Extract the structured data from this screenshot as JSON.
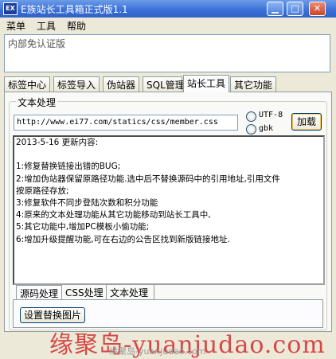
{
  "window": {
    "app_icon": "EX",
    "title": "E族站长工具箱正式版1.1",
    "minimize_icon": "minimize-icon",
    "maximize_icon": "maximize-icon",
    "close_icon": "close-icon"
  },
  "menu": [
    {
      "label": "菜单"
    },
    {
      "label": "工具"
    },
    {
      "label": "帮助"
    }
  ],
  "notice_text": "内部免认证版",
  "tabs": [
    {
      "label": "标签中心",
      "active": false
    },
    {
      "label": "标签导入",
      "active": false
    },
    {
      "label": "伪站器",
      "active": false
    },
    {
      "label": "SQL管理",
      "active": false
    },
    {
      "label": "站长工具",
      "active": true
    },
    {
      "label": "其它功能",
      "active": false
    }
  ],
  "text_processing": {
    "legend": "文本处理",
    "url_value": "http://www.ei77.com/statics/css/member.css",
    "encodings": [
      {
        "label": "UTF-8",
        "selected": false
      },
      {
        "label": "gbk",
        "selected": false
      }
    ],
    "load_button": "加载",
    "changelog_lines": [
      "     2013-5-16   更新内容:",
      "",
      "1:修复替换链接出错的BUG;",
      "2:增加伪站器保留原路径功能.选中后不替换源码中的引用地址,引用文件",
      "按原路径存放;",
      "3:修复软件不同步登陆次数和积分功能",
      "4:原来的文本处理功能从其它功能移动到站长工具中,",
      "5:其它功能中,增加PC模板小偷功能;",
      "6:增加升级提醒功能,可在右边的公告区找到新版链接地址."
    ]
  },
  "subtabs": [
    {
      "label": "源码处理",
      "active": true
    },
    {
      "label": "CSS处理",
      "active": false
    },
    {
      "label": "文本处理",
      "active": false
    }
  ],
  "replace_button": "设置替换图片",
  "watermark": {
    "main": "缘聚岛-yuanjudao.com",
    "small": "缘聚岛-yuanjudao.com"
  }
}
